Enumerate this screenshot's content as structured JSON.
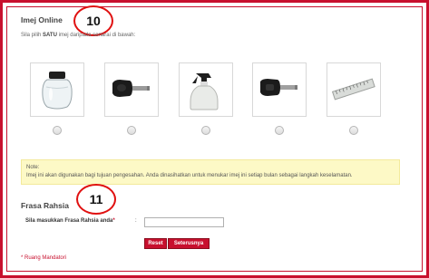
{
  "online_image": {
    "title": "Imej Online",
    "instruction_prefix": "Sila pilih ",
    "instruction_bold": "SATU",
    "instruction_suffix": " imej daripada senarai di bawah:",
    "callout": "10",
    "images": [
      {
        "icon": "glass-jar-icon"
      },
      {
        "icon": "car-key-icon"
      },
      {
        "icon": "spray-bottle-icon"
      },
      {
        "icon": "car-key-icon"
      },
      {
        "icon": "ruler-icon"
      }
    ]
  },
  "note": {
    "label": "Note:",
    "text": "Imej ini akan digunakan bagi tujuan pengesahan. Anda dinasihatkan untuk menukar imej ini setiap bulan sebagai langkah keselamatan."
  },
  "secret_phrase": {
    "title": "Frasa Rahsia",
    "callout": "11",
    "field_label": "Sila masukkan Frasa Rahsia anda",
    "required_mark": "*",
    "colon": ":",
    "value": ""
  },
  "buttons": {
    "reset": "Reset",
    "next": "Seterusnya"
  },
  "mandatory_note": "* Ruang Mandatori",
  "colors": {
    "accent": "#c8102e",
    "note_bg": "#fdf9c6",
    "callout_ring": "#e01010"
  }
}
